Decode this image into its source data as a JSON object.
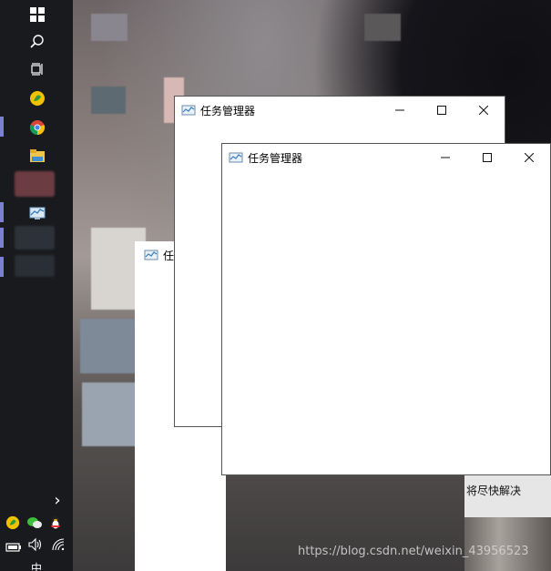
{
  "windows": [
    {
      "title": "任务管理器",
      "buttons": {
        "minimize": "—",
        "maximize": "☐",
        "close": "✕"
      }
    },
    {
      "title": "任务管理器",
      "buttons": {
        "minimize": "—",
        "maximize": "☐",
        "close": "✕"
      }
    }
  ],
  "partial_window": {
    "title": "任务"
  },
  "background_text": "将尽快解决",
  "watermark": "https://blog.csdn.net/weixin_43956523",
  "taskbar": {
    "icons": [
      "windows-start",
      "search",
      "task-view",
      "app-green-yellow",
      "chrome",
      "file-explorer",
      "blurred-app",
      "task-manager",
      "blurred-app-2",
      "blurred-app-3"
    ],
    "tray": {
      "expand": "›",
      "ime": "中"
    }
  },
  "colors": {
    "taskbar": "#191a1d",
    "indicator": "#7f7fd0"
  }
}
